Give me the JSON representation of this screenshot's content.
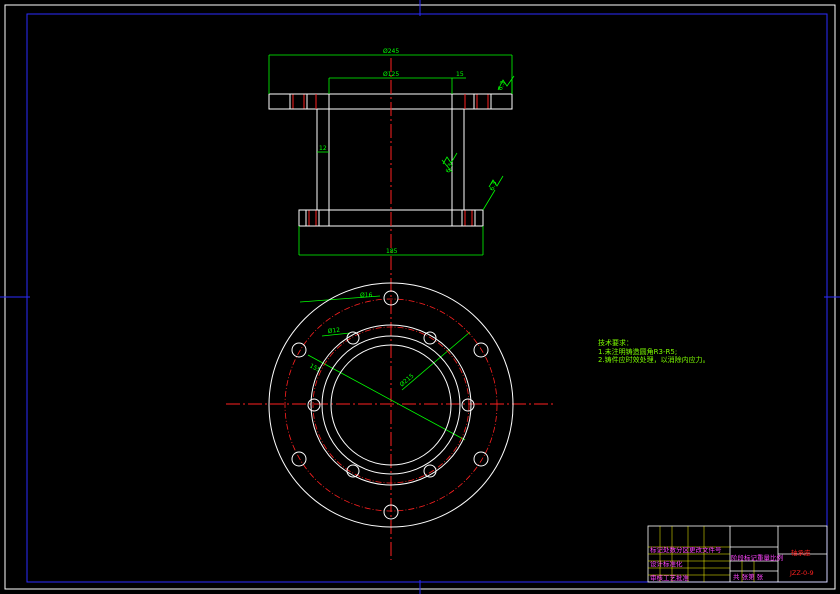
{
  "drawing": {
    "dimensions": {
      "outer_dia": "Ø245",
      "inner_dia": "Ø125",
      "flange_thk": "15",
      "wall": "12",
      "base_width": "185",
      "roughness_1": "6.3",
      "roughness_2": "6.3",
      "roughness_3": "6.3",
      "bolt_hole": "Ø16",
      "small_hole": "Ø12",
      "pcd_1": "Ø215",
      "pcd_2": "155"
    },
    "notes": {
      "heading": "技术要求：",
      "line1": "1.未注明铸造圆角R3-R5;",
      "line2": "2.铸件应时效处理，以消除内应力。"
    },
    "title_block": {
      "part_name": "轴承座",
      "drawing_no": "JZZ-0-9",
      "row_a": "标记处数分区更改文件号",
      "row_b": "设计标准化",
      "row_c": "审核工艺批准",
      "scale_label": "阶段标记重量比例",
      "sheet": "共 张第 张"
    }
  }
}
